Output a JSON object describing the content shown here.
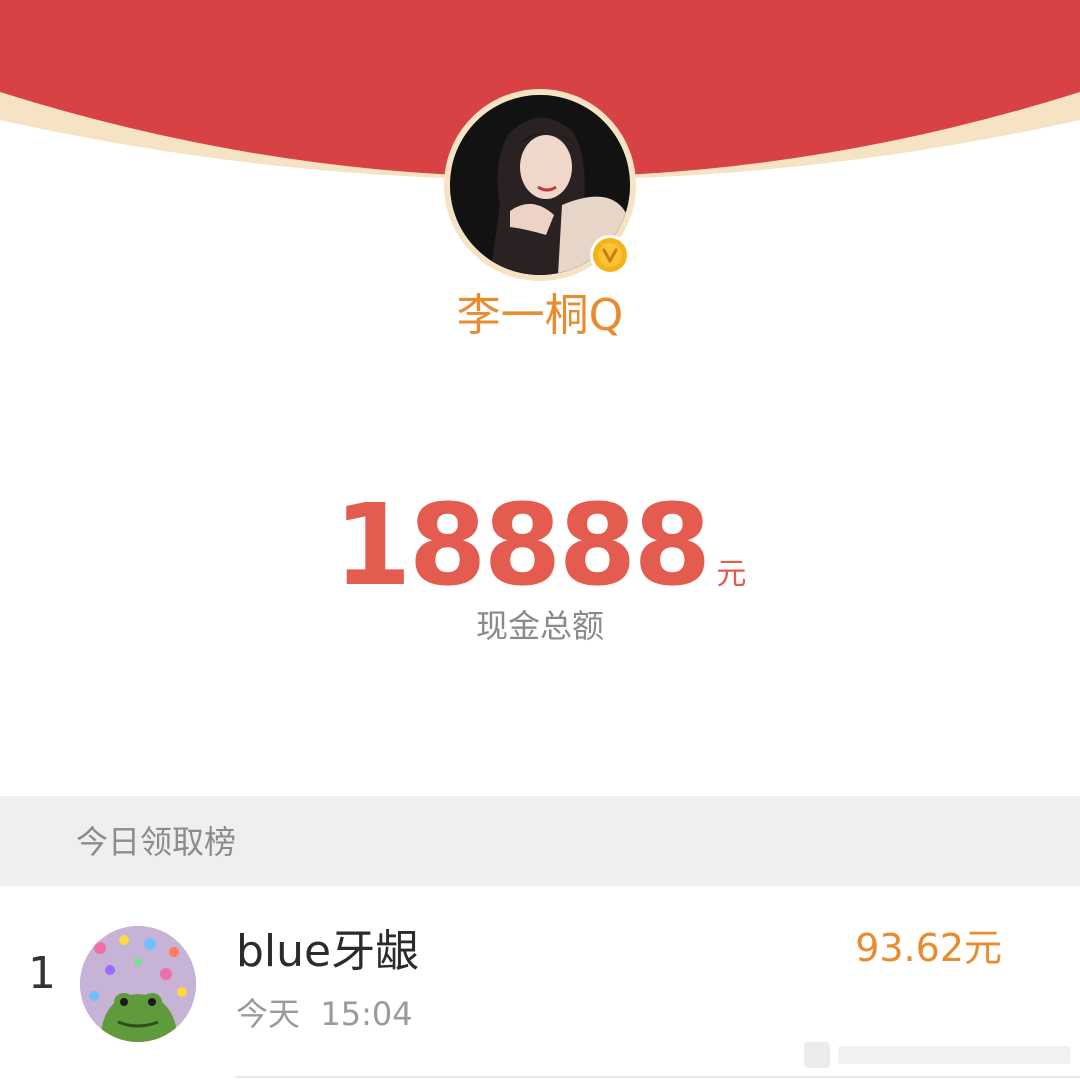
{
  "colors": {
    "header_red": "#d94244",
    "header_rim": "#f6e3c4",
    "accent_orange": "#e98b2f",
    "amount_red": "#e35c4f",
    "section_bg": "#efefef"
  },
  "host": {
    "avatar_icon": "user-photo",
    "verified_badge": "V",
    "name": "李一桐Q"
  },
  "total": {
    "amount": "18888",
    "unit": "元",
    "label": "现金总额"
  },
  "leaderboard": {
    "title": "今日领取榜",
    "entries": [
      {
        "rank": "1",
        "avatar_icon": "frog-with-hearts-avatar",
        "name": "blue牙龈",
        "time": "今天  15:04",
        "amount": "93.62元"
      }
    ]
  }
}
